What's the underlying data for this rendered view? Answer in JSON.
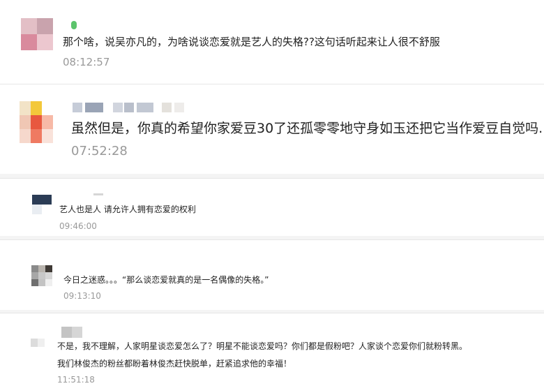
{
  "messages": [
    {
      "text": "那个啥，说吴亦凡的，为啥说谈恋爱就是艺人的失格??这句话听起来让人很不舒服",
      "time": "08:12:57"
    },
    {
      "text": "虽然但是，你真的希望你家爱豆30了还孤零零地守身如玉还把它当作爱豆自觉吗.",
      "time": "07:52:28"
    },
    {
      "text": "艺人也是人 请允许人拥有恋爱的权利",
      "time": "09:46:00"
    },
    {
      "text": "今日之迷惑。。。“那么谈恋爱就真的是一名偶像的失格。”",
      "time": "09:13:10"
    },
    {
      "text_line1": "不是，我不理解，人家明星谈恋爱怎么了？明星不能谈恋爱吗？你们都是假粉吧？人家谈个恋爱你们就粉转黑。",
      "text_line2": "我们林俊杰的粉丝都盼着林俊杰赶快脱单，赶紧追求他的幸福！",
      "time": "11:51:18"
    }
  ],
  "colors": {
    "page_background": "#f4f4f4",
    "card_background": "#ffffff",
    "message_text": "#222222",
    "timestamp_text": "#999999",
    "divider": "#e6e6e6"
  }
}
